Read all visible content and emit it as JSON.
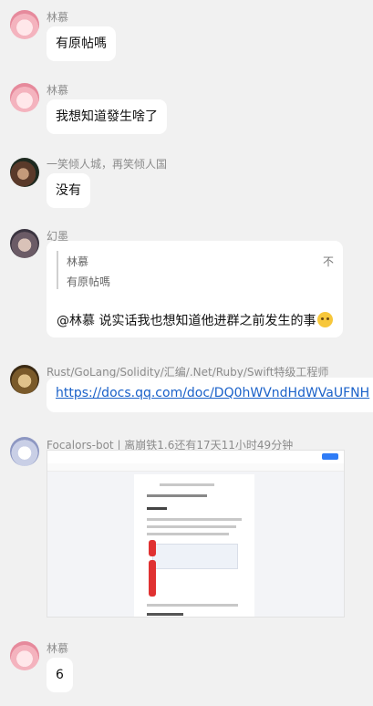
{
  "messages": [
    {
      "sender": "林慕",
      "text": "有原帖嗎"
    },
    {
      "sender": "林慕",
      "text": "我想知道發生啥了"
    },
    {
      "sender": "一笑倾人城，再笑倾人国",
      "text": "没有"
    },
    {
      "sender": "幻墨",
      "quote": {
        "name": "林慕",
        "text": "有原帖嗎",
        "right": "不"
      },
      "text": "@林慕 说实话我也想知道他进群之前发生的事"
    },
    {
      "sender": "Rust/GoLang/Solidity/汇编/.Net/Ruby/Swift特级工程师",
      "link": "https://docs.qq.com/doc/DQ0hWVndHdWVaUFNH"
    },
    {
      "sender": "Focalors-bot | 离崩铁1.6还有17天11小时49分钟",
      "image_caption": "[screenshot of document]"
    },
    {
      "sender": "林慕",
      "text": "6"
    }
  ],
  "colors": {
    "background": "#f1f1f1",
    "bubble": "#ffffff",
    "link": "#1a61c9",
    "sender": "#8c8c8c"
  },
  "icons": {
    "emoji": "smiling-face-emoji"
  }
}
